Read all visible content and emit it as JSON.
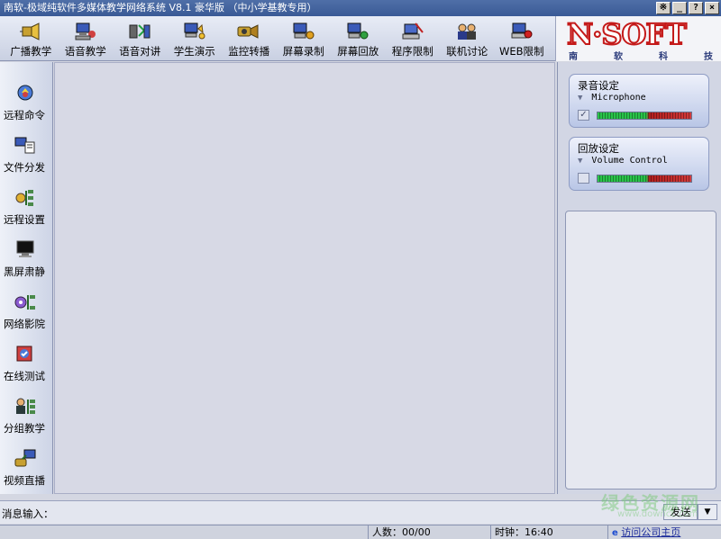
{
  "window": {
    "title": "南软-极域纯软件多媒体教学网络系统 V8.1 豪华版 （中小学基教专用）",
    "buttons": [
      "※",
      "_",
      "?",
      "×"
    ]
  },
  "toolbar": {
    "items": [
      {
        "label": "广播教学",
        "icon": "broadcast-icon"
      },
      {
        "label": "语音教学",
        "icon": "voice-teaching-icon"
      },
      {
        "label": "语音对讲",
        "icon": "voice-intercom-icon"
      },
      {
        "label": "学生演示",
        "icon": "student-demo-icon"
      },
      {
        "label": "监控转播",
        "icon": "monitor-relay-icon"
      },
      {
        "label": "屏幕录制",
        "icon": "screen-record-icon"
      },
      {
        "label": "屏幕回放",
        "icon": "screen-playback-icon"
      },
      {
        "label": "程序限制",
        "icon": "program-limit-icon"
      },
      {
        "label": "联机讨论",
        "icon": "online-discussion-icon"
      },
      {
        "label": "WEB限制",
        "icon": "web-limit-icon"
      }
    ]
  },
  "logo": {
    "text": "N·SOFT",
    "subtitle": [
      "南",
      "软",
      "科",
      "技"
    ]
  },
  "sidebar": {
    "items": [
      {
        "label": "远程命令",
        "icon": "remote-command-icon"
      },
      {
        "label": "文件分发",
        "icon": "file-distribute-icon"
      },
      {
        "label": "远程设置",
        "icon": "remote-settings-icon"
      },
      {
        "label": "黑屏肃静",
        "icon": "black-screen-icon"
      },
      {
        "label": "网络影院",
        "icon": "network-cinema-icon"
      },
      {
        "label": "在线测试",
        "icon": "online-test-icon"
      },
      {
        "label": "分组教学",
        "icon": "group-teaching-icon"
      },
      {
        "label": "视频直播",
        "icon": "video-live-icon"
      }
    ]
  },
  "right_panel": {
    "record": {
      "title": "录音设定",
      "device": "Microphone",
      "checked": true,
      "level": 0.53
    },
    "playback": {
      "title": "回放设定",
      "device": "Volume Control",
      "checked": false,
      "level": 0.53
    }
  },
  "message_bar": {
    "label": "消息输入：",
    "send_label": "发送",
    "input_value": ""
  },
  "status": {
    "count": "人数：00/00",
    "clock": "时钟：16:40",
    "link": "访问公司主页"
  },
  "watermark": {
    "text": "绿色资源网",
    "url": "www.downcc.com"
  },
  "colors": {
    "meter_green": "#29c34a",
    "meter_red": "#b31e1e",
    "logo_red": "#c41a1a"
  }
}
